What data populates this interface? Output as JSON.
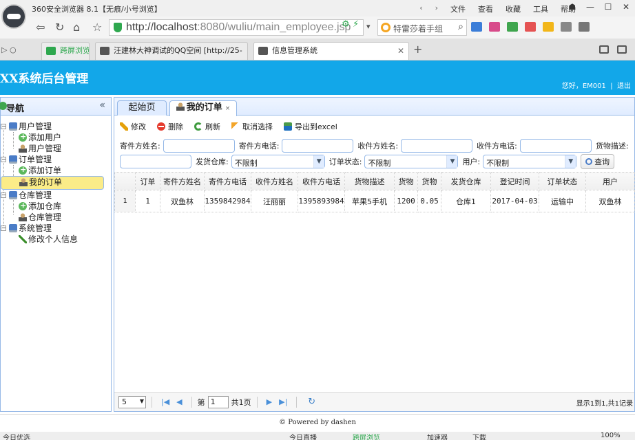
{
  "browser": {
    "title": "360安全浏览器 8.1【无痕/小号浏览】",
    "menu": [
      "文件",
      "查看",
      "收藏",
      "工具",
      "帮助"
    ],
    "url_host": "http://localhost",
    "url_path": ":8080/wuliu/main_employee.jsp",
    "search_text": "特雷莎着手组",
    "tabs": [
      {
        "label": "跨屏浏览"
      },
      {
        "label": "汪建林大神调试的QQ空间 [http://25-"
      },
      {
        "label": "信息管理系统"
      }
    ],
    "status_left": "今日优选",
    "status_items": [
      "今日直播",
      "跨屏浏览",
      "加速器",
      "下载"
    ],
    "zoom": "100%"
  },
  "app": {
    "title": "XX系统后台管理",
    "greeting": "您好，EM001",
    "logout": "退出"
  },
  "sidebar": {
    "title": "导航",
    "groups": [
      {
        "label": "用户管理",
        "items": [
          "添加用户",
          "用户管理"
        ]
      },
      {
        "label": "订单管理",
        "items": [
          "添加订单",
          "我的订单"
        ]
      },
      {
        "label": "仓库管理",
        "items": [
          "添加仓库",
          "仓库管理"
        ]
      },
      {
        "label": "系统管理",
        "items": [
          "修改个人信息"
        ]
      }
    ]
  },
  "tabs": {
    "home": "起始页",
    "orders": "我的订单",
    "close": "×"
  },
  "toolbar": {
    "edit": "修改",
    "delete": "删除",
    "refresh": "刷新",
    "cancel": "取消选择",
    "export": "导出到excel"
  },
  "filters": {
    "sender_name": "寄件方姓名:",
    "sender_phone": "寄件方电话:",
    "receiver_name": "收件方姓名:",
    "receiver_phone": "收件方电话:",
    "goods_desc": "货物描述:",
    "warehouse": "发货仓库:",
    "warehouse_value": "不限制",
    "status": "订单状态:",
    "status_value": "不限制",
    "user": "用户:",
    "user_value": "不限制",
    "query": "查询"
  },
  "grid": {
    "columns": [
      "订单",
      "寄件方姓名",
      "寄件方电话",
      "收件方姓名",
      "收件方电话",
      "货物描述",
      "货物",
      "货物",
      "发货仓库",
      "登记时间",
      "订单状态",
      "用户"
    ],
    "rows": [
      {
        "rownum": "1",
        "cells": [
          "1",
          "双鱼林",
          "1359842984",
          "汪丽丽",
          "1395893984",
          "苹果5手机",
          "1200",
          "0.05",
          "仓库1",
          "2017-04-03",
          "运输中",
          "双鱼林"
        ]
      }
    ]
  },
  "pager": {
    "page_size": "5",
    "page_label": "第",
    "page_value": "1",
    "total_pages": "共1页",
    "info": "显示1到1,共1记录"
  },
  "footer": "© Powered by dashen"
}
